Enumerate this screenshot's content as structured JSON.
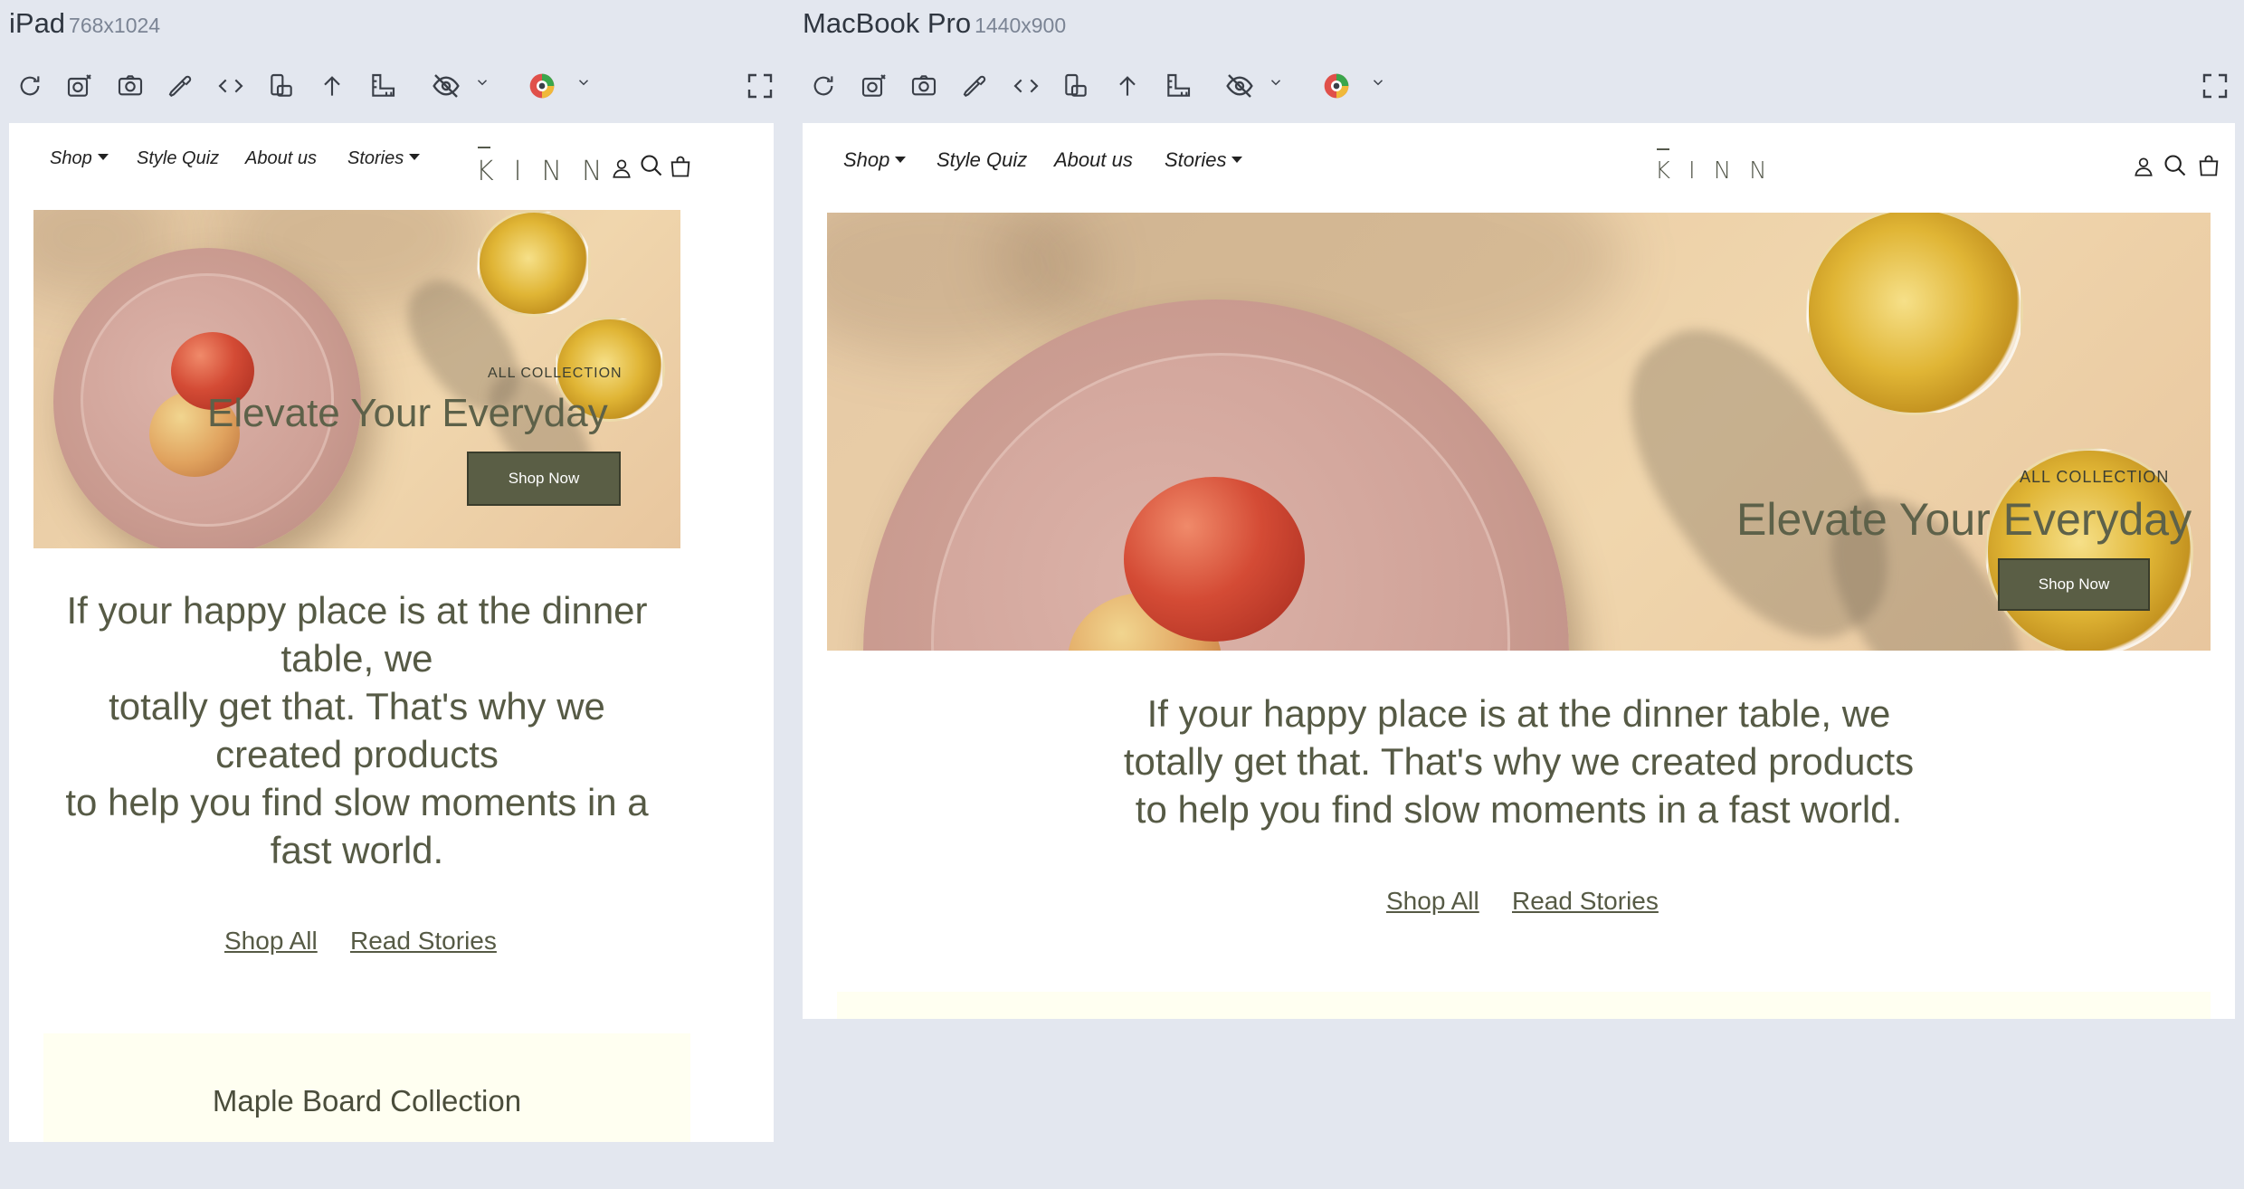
{
  "devices": [
    {
      "name": "iPad",
      "size": "768x1024",
      "nav": {
        "shop": "Shop",
        "style_quiz": "Style Quiz",
        "about": "About us",
        "stories": "Stories"
      },
      "logo": "KINN",
      "hero": {
        "eyebrow": "ALL COLLECTION",
        "title": "Elevate Your Everyday",
        "button": "Shop Now"
      },
      "tagline_lines": [
        "If your happy place is at the dinner",
        "table, we",
        "totally get that. That's why we",
        "created products",
        "to help you find slow moments in a",
        "fast world."
      ],
      "links": {
        "shop_all": "Shop All",
        "read_stories": "Read Stories"
      },
      "promo": {
        "title": "Maple Board Collection"
      }
    },
    {
      "name": "MacBook Pro",
      "size": "1440x900",
      "nav": {
        "shop": "Shop",
        "style_quiz": "Style Quiz",
        "about": "About us",
        "stories": "Stories"
      },
      "logo": "KINN",
      "hero": {
        "eyebrow": "ALL COLLECTION",
        "title": "Elevate Your Everyday",
        "button": "Shop Now"
      },
      "tagline_lines": [
        "If your happy place is at the dinner table, we",
        "totally get that. That's why we created products",
        "to help you find slow moments in a fast world."
      ],
      "links": {
        "shop_all": "Shop All",
        "read_stories": "Read Stories"
      },
      "promo": {
        "title": ""
      }
    }
  ],
  "toolbar_icons": [
    "refresh-icon",
    "screenshot-timer-icon",
    "camera-icon",
    "eyedropper-icon",
    "code-icon",
    "rotate-device-icon",
    "scroll-up-icon",
    "ruler-icon",
    "visibility-icon",
    "color-blind-icon",
    "fullscreen-icon"
  ],
  "colors": {
    "background": "#e3e7ef",
    "brand_olive": "#5a5e45",
    "text_olive": "#565a45",
    "promo_bg": "#fffff1"
  }
}
